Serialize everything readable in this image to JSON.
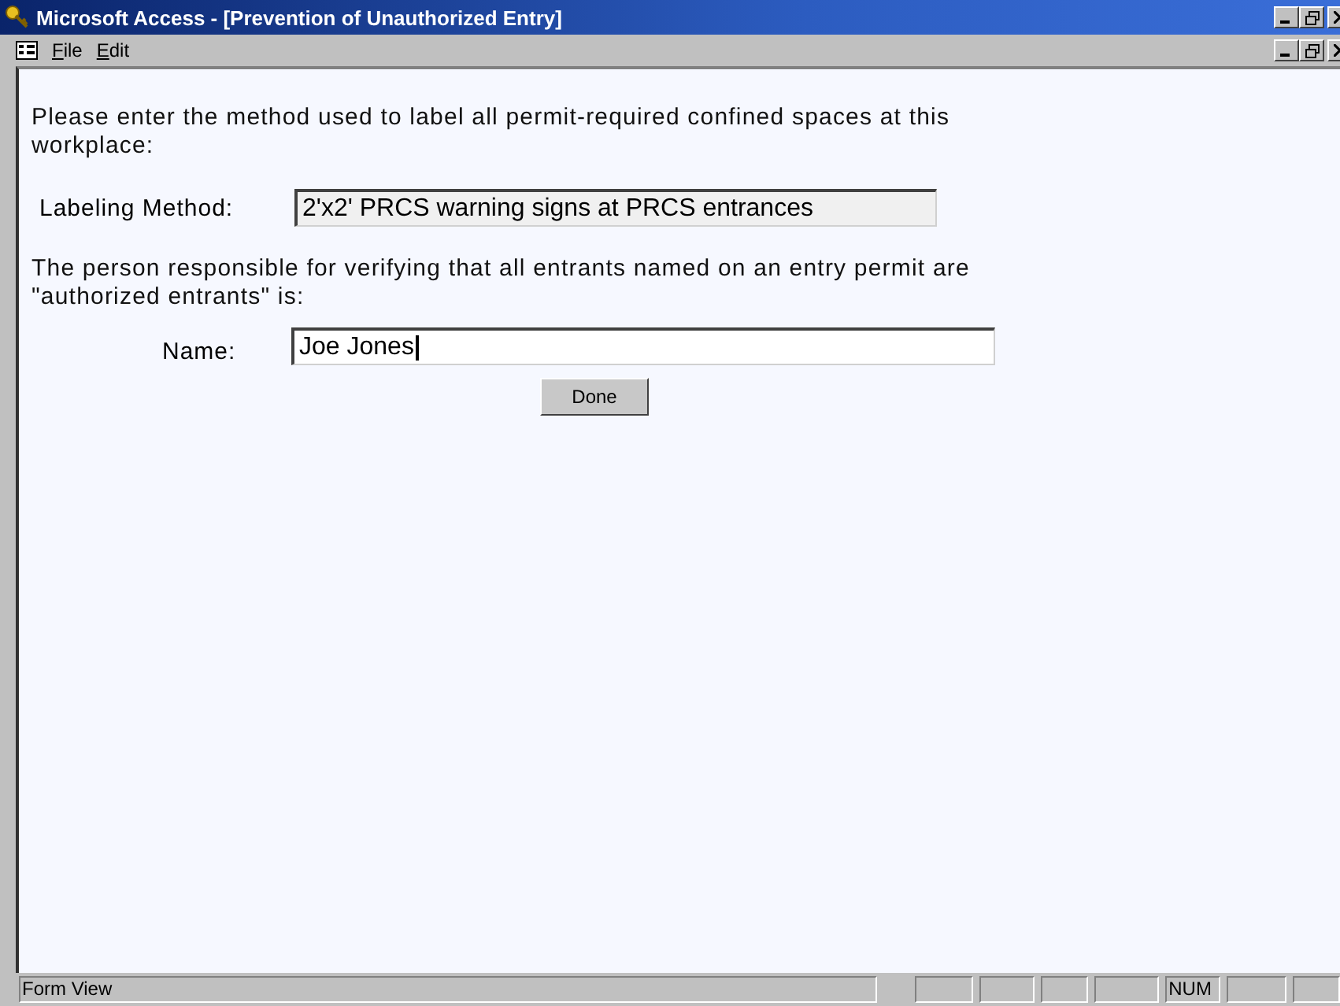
{
  "window": {
    "title": "Microsoft Access - [Prevention of Unauthorized Entry]"
  },
  "menu": [
    {
      "label": "File"
    },
    {
      "label": "Edit"
    }
  ],
  "form": {
    "prompt_1": "Please enter the method used to label all permit-required confined spaces at this workplace:",
    "labeling_method": {
      "label": "Labeling Method:",
      "value": "2'x2' PRCS warning signs at PRCS entrances",
      "focused": false
    },
    "prompt_2": "The person responsible for verifying that all entrants named on an entry permit are \"authorized entrants\" is:",
    "name": {
      "label": "Name:",
      "value": "Joe Jones",
      "focused": true
    },
    "button": "Done"
  },
  "status_bar": {
    "text": "Form View",
    "num_indicator": "NUM"
  }
}
